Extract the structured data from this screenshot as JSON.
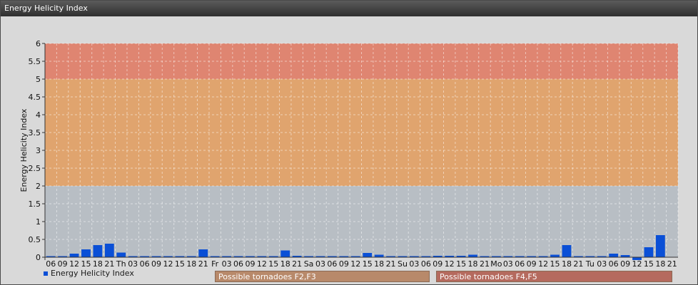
{
  "window": {
    "title": "Energy Helicity Index"
  },
  "colors": {
    "bar": "#0a4fd6",
    "band_low": "#b8bec4",
    "band_mid": "#e0a46e",
    "band_high": "#df8571",
    "plot_bg": "#d9d9d9"
  },
  "bands": [
    {
      "name": "Possible tornadoes F2,F3",
      "from": 2,
      "to": 5,
      "color": "#e0a46e"
    },
    {
      "name": "Possible tornadoes F4,F5",
      "from": 5,
      "to": 6,
      "color": "#df8571"
    }
  ],
  "legend": {
    "label": "Energy Helicity Index",
    "placement": "bottom-left"
  },
  "chart_data": {
    "type": "bar",
    "ylabel": "Energy Helicity Index",
    "xlabel": "",
    "ylim": [
      0,
      6
    ],
    "yticks": [
      "0",
      "0.5",
      "1",
      "1.5",
      "2",
      "2.5",
      "3",
      "3.5",
      "4",
      "4.5",
      "5",
      "5.5",
      "6"
    ],
    "grid": true,
    "categories": [
      "06",
      "09",
      "12",
      "15",
      "18",
      "21",
      "Th",
      "03",
      "06",
      "09",
      "12",
      "15",
      "18",
      "21",
      "Fr",
      "03",
      "06",
      "09",
      "12",
      "15",
      "18",
      "21",
      "Sa",
      "03",
      "06",
      "09",
      "12",
      "15",
      "18",
      "21",
      "Su",
      "03",
      "06",
      "09",
      "12",
      "15",
      "18",
      "21",
      "Mo",
      "03",
      "06",
      "09",
      "12",
      "15",
      "18",
      "21",
      "Tu",
      "03",
      "06",
      "09",
      "12",
      "15",
      "18",
      "21"
    ],
    "series": [
      {
        "name": "Energy Helicity Index",
        "values": [
          0.0,
          0.02,
          0.1,
          0.22,
          0.34,
          0.38,
          0.13,
          0.02,
          0.01,
          0.01,
          0.02,
          0.02,
          0.01,
          0.22,
          0.01,
          0.01,
          0.01,
          0.01,
          0.01,
          0.01,
          0.19,
          0.04,
          0.02,
          0.02,
          0.02,
          0.02,
          0.02,
          0.12,
          0.07,
          0.02,
          0.02,
          0.01,
          0.03,
          0.04,
          0.04,
          0.04,
          0.07,
          0.02,
          0.01,
          0.01,
          0.01,
          0.03,
          0.03,
          0.07,
          0.34,
          0.01,
          0.01,
          0.02,
          0.1,
          0.06,
          -0.08,
          0.28,
          0.62
        ]
      }
    ]
  }
}
